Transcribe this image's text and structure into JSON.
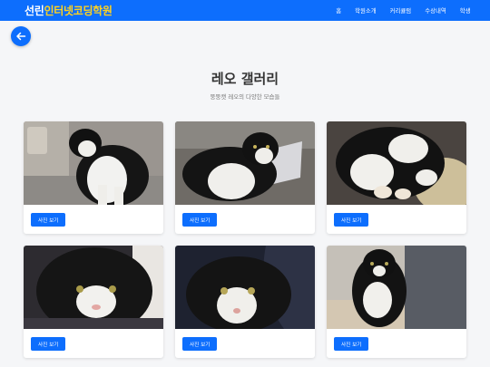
{
  "header": {
    "brand_part1": "선린",
    "brand_part2": "인터넷코딩학원",
    "nav": [
      "홈",
      "학원소개",
      "커리큘럼",
      "수상내역",
      "학생"
    ]
  },
  "page": {
    "title": "레오 갤러리",
    "subtitle": "뚱뚱캣 레오의 다양한 모습들"
  },
  "gallery": {
    "button_label": "사진 보기",
    "photos": [
      "cat-photo-1",
      "cat-photo-2",
      "cat-photo-3",
      "cat-photo-4",
      "cat-photo-5",
      "cat-photo-6"
    ]
  },
  "colors": {
    "primary": "#0d6efd",
    "brand_highlight": "#ffd21f",
    "background": "#f5f6f8"
  },
  "icons": {
    "back": "arrow-left-icon"
  }
}
